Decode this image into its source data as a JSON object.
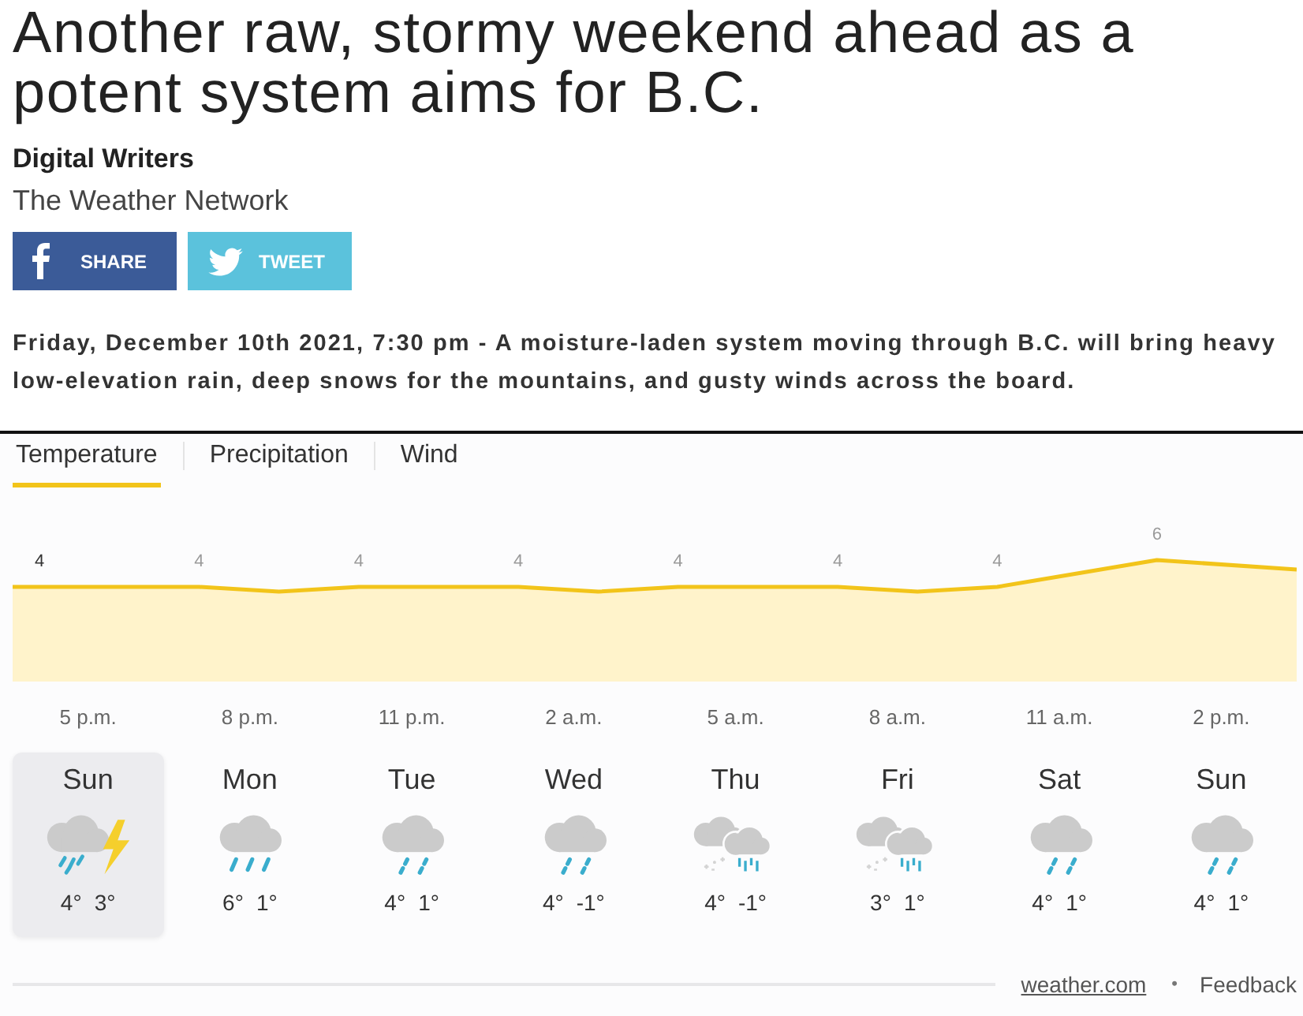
{
  "article": {
    "title": "Another raw, stormy weekend ahead as a potent system aims for B.C.",
    "author": "Digital Writers",
    "source": "The Weather Network",
    "share_buttons": [
      {
        "kind": "facebook",
        "label": "SHARE"
      },
      {
        "kind": "twitter",
        "label": "TWEET"
      }
    ],
    "summary": "Friday, December 10th 2021, 7:30 pm - A moisture-laden system moving through B.C. will bring heavy low-elevation rain, deep snows for the mountains, and gusty winds across the board."
  },
  "weather_widget": {
    "tabs": [
      {
        "label": "Temperature",
        "selected": true
      },
      {
        "label": "Precipitation",
        "selected": false
      },
      {
        "label": "Wind",
        "selected": false
      }
    ],
    "hourly": [
      {
        "temperature": "4",
        "time": "5 p.m."
      },
      {
        "temperature": "4",
        "time": "8 p.m."
      },
      {
        "temperature": "4",
        "time": "11 p.m."
      },
      {
        "temperature": "4",
        "time": "2 a.m."
      },
      {
        "temperature": "4",
        "time": "5 a.m."
      },
      {
        "temperature": "4",
        "time": "8 a.m."
      },
      {
        "temperature": "4",
        "time": "11 a.m."
      },
      {
        "temperature": "6",
        "time": "2 p.m."
      }
    ],
    "days": [
      {
        "day": "Sun",
        "kind": "thunderstorm",
        "high": "4°",
        "low": "3°",
        "selected": true
      },
      {
        "day": "Mon",
        "kind": "downpour",
        "high": "6°",
        "low": "1°",
        "selected": false
      },
      {
        "day": "Tue",
        "kind": "rain",
        "high": "4°",
        "low": "1°",
        "selected": false
      },
      {
        "day": "Wed",
        "kind": "rain",
        "high": "4°",
        "low": "-1°",
        "selected": false
      },
      {
        "day": "Thu",
        "kind": "sleet",
        "high": "4°",
        "low": "-1°",
        "selected": false
      },
      {
        "day": "Fri",
        "kind": "sleet",
        "high": "3°",
        "low": "1°",
        "selected": false
      },
      {
        "day": "Sat",
        "kind": "rain",
        "high": "4°",
        "low": "1°",
        "selected": false
      },
      {
        "day": "Sun",
        "kind": "rain",
        "high": "4°",
        "low": "1°",
        "selected": false
      }
    ],
    "footer": {
      "link": "weather.com",
      "separator": "•",
      "feedback": "Feedback"
    }
  }
}
